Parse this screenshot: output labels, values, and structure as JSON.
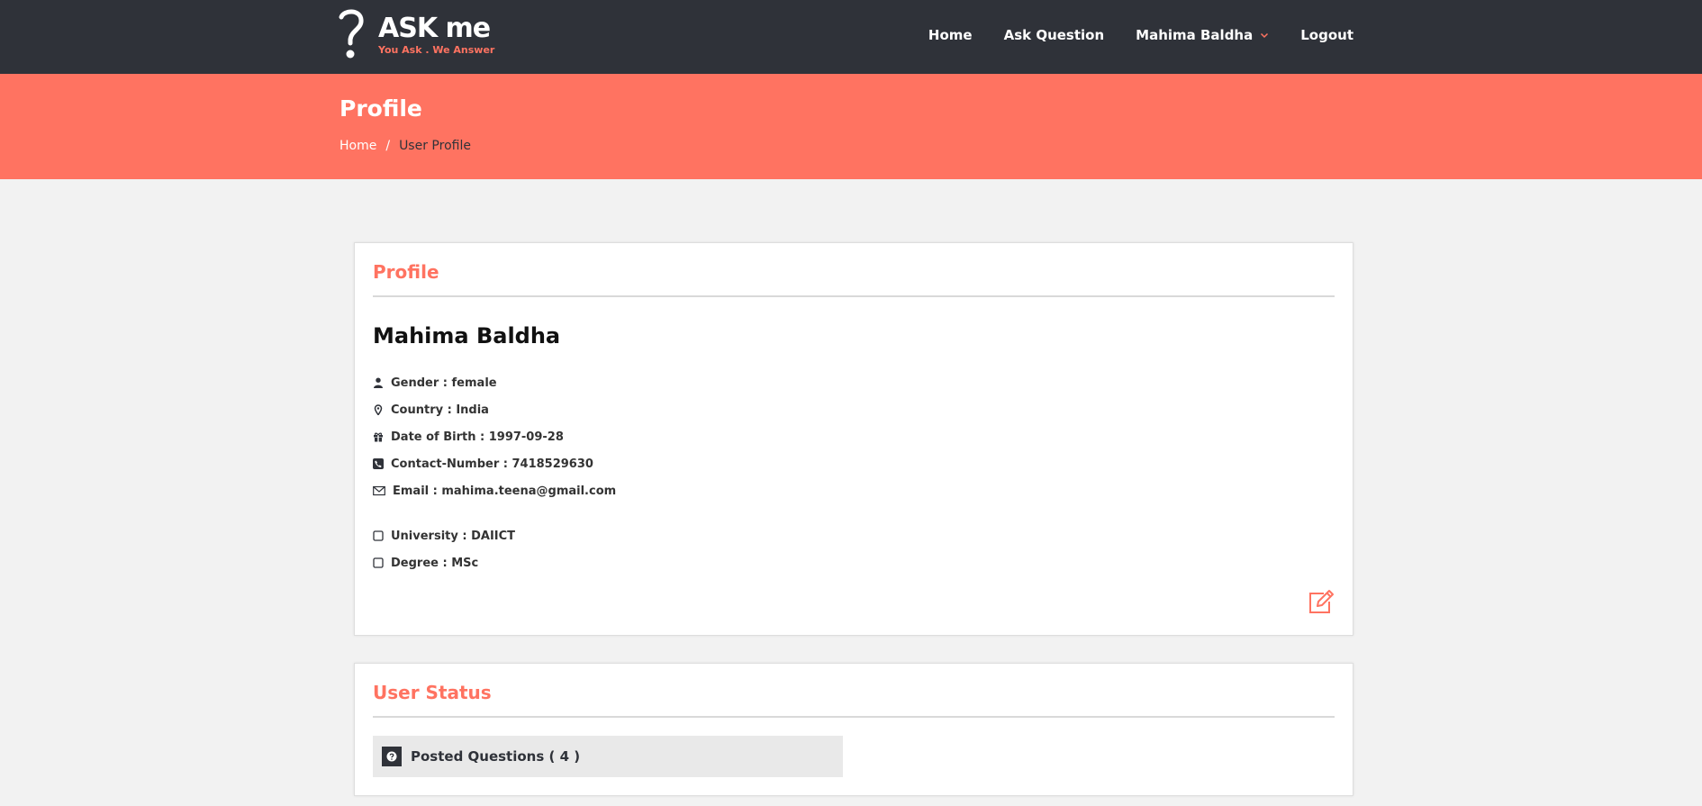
{
  "brand": {
    "title": "ASK me",
    "tagline": "You Ask . We Answer",
    "accent": "#ff7361",
    "dark": "#2f3239"
  },
  "nav": {
    "home": "Home",
    "ask": "Ask Question",
    "user": "Mahima Baldha",
    "logout": "Logout"
  },
  "banner": {
    "title": "Profile",
    "breadcrumb": {
      "home": "Home",
      "separator": "/",
      "current": "User Profile"
    }
  },
  "profile": {
    "heading": "Profile",
    "name": "Mahima Baldha",
    "fields": [
      {
        "icon": "user-icon",
        "label": "Gender : female"
      },
      {
        "icon": "map-marker-icon",
        "label": "Country : India"
      },
      {
        "icon": "gift-icon",
        "label": "Date of Birth : 1997-09-28"
      },
      {
        "icon": "phone-icon",
        "label": "Contact-Number : 7418529630"
      },
      {
        "icon": "envelope-icon",
        "label": "Email : mahima.teena@gmail.com"
      },
      {
        "icon": "square-icon",
        "label": "University : DAIICT"
      },
      {
        "icon": "square-icon",
        "label": "Degree : MSc"
      }
    ],
    "edit_icon": "edit-icon"
  },
  "status": {
    "heading": "User Status",
    "posted_questions": "Posted Questions ( 4 )",
    "icon": "question-circle-icon"
  }
}
